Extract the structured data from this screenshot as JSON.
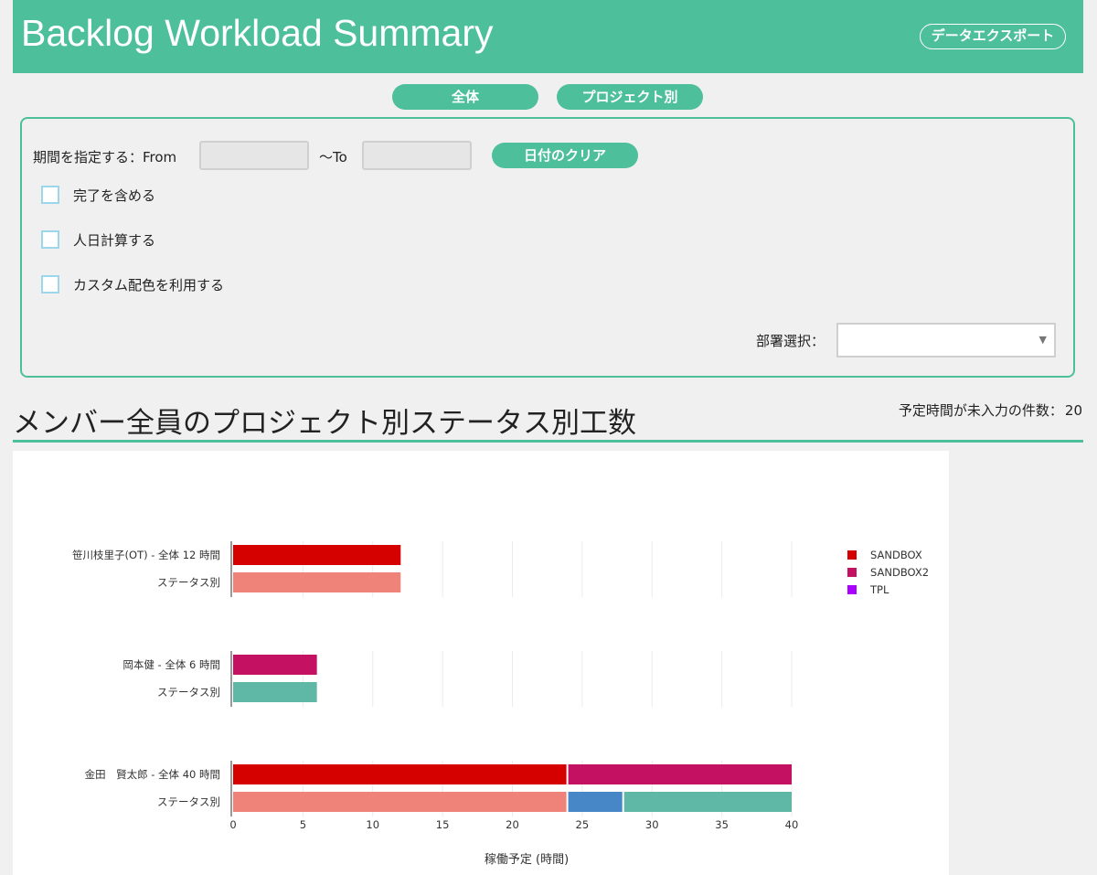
{
  "header": {
    "title": "Backlog Workload Summary",
    "export_label": "データエクスポート"
  },
  "tabs": [
    {
      "label": "全体"
    },
    {
      "label": "プロジェクト別"
    }
  ],
  "filters": {
    "period_label": "期間を指定する：From",
    "to_label": "〜To",
    "from_value": "",
    "to_value": "",
    "clear_label": "日付のクリア",
    "checkboxes": [
      {
        "label": "完了を含める",
        "checked": false
      },
      {
        "label": "人日計算する",
        "checked": false
      },
      {
        "label": "カスタム配色を利用する",
        "checked": false
      }
    ],
    "department_label": "部署選択：",
    "department_value": ""
  },
  "section": {
    "title": "メンバー全員のプロジェクト別ステータス別工数",
    "count_label": "予定時間が未入力の件数：",
    "count_value": "20"
  },
  "chart_data": {
    "type": "bar",
    "orientation": "horizontal",
    "stacked": true,
    "xlabel": "稼働予定 (時間)",
    "xlim": [
      0,
      40
    ],
    "xticks": [
      0,
      5,
      10,
      15,
      20,
      25,
      30,
      35,
      40
    ],
    "grid": true,
    "legend": {
      "placement": "top-right",
      "entries": [
        {
          "name": "SANDBOX",
          "color": "#d50000"
        },
        {
          "name": "SANDBOX2",
          "color": "#c51162"
        },
        {
          "name": "TPL",
          "color": "#aa00ff"
        }
      ]
    },
    "groups": [
      {
        "rows": [
          {
            "label": "笹川枝里子(OT) - 全体 12 時間",
            "segments": [
              {
                "value": 12,
                "color": "#d50000"
              }
            ]
          },
          {
            "label": "ステータス別",
            "segments": [
              {
                "value": 12,
                "color": "#ef8279"
              }
            ]
          }
        ]
      },
      {
        "rows": [
          {
            "label": "岡本健 - 全体 6 時間",
            "segments": [
              {
                "value": 6,
                "color": "#c51162"
              }
            ]
          },
          {
            "label": "ステータス別",
            "segments": [
              {
                "value": 6,
                "color": "#5fb7a6"
              }
            ]
          }
        ]
      },
      {
        "rows": [
          {
            "label": "金田　賢太郎 - 全体 40 時間",
            "segments": [
              {
                "value": 24,
                "color": "#d50000"
              },
              {
                "value": 16,
                "color": "#c51162"
              }
            ]
          },
          {
            "label": "ステータス別",
            "segments": [
              {
                "value": 24,
                "color": "#ef8279"
              },
              {
                "value": 4,
                "color": "#4787c7"
              },
              {
                "value": 12,
                "color": "#5fb7a6"
              }
            ]
          }
        ]
      }
    ]
  }
}
